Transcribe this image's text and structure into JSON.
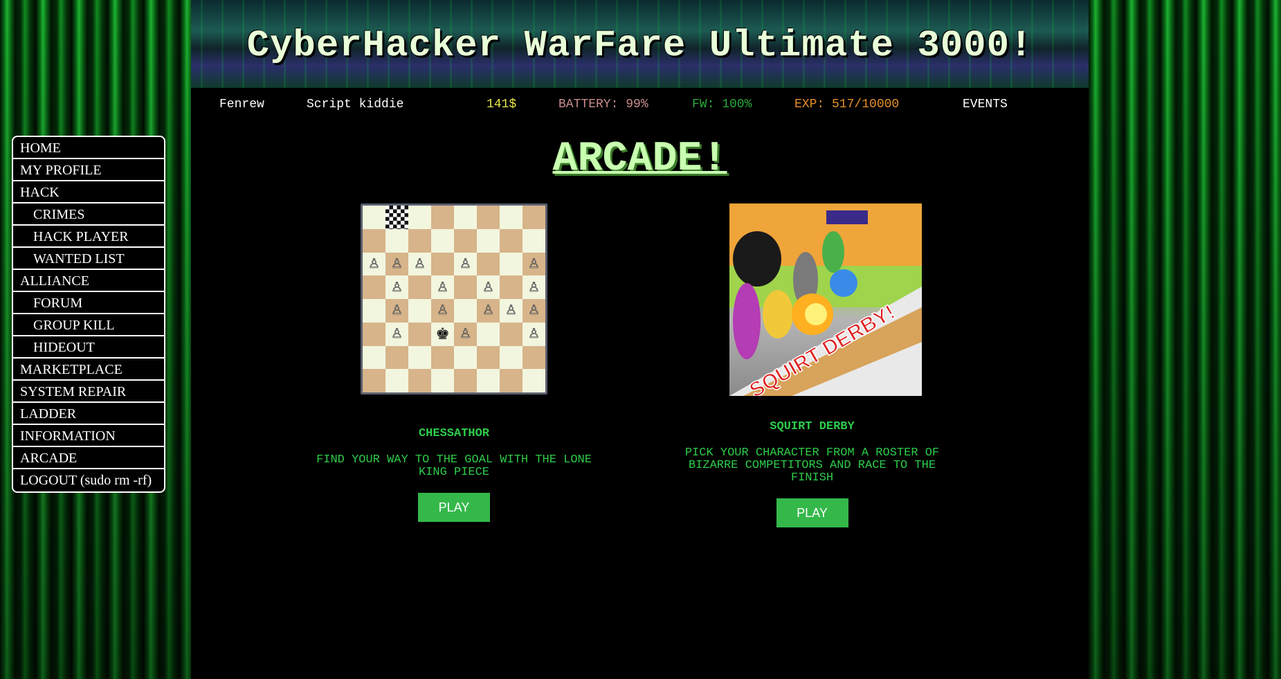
{
  "banner": {
    "title": "CyberHacker WarFare Ultimate 3000!"
  },
  "status": {
    "username": "Fenrew",
    "rank": "Script kiddie",
    "money": "141$",
    "battery": "BATTERY: 99%",
    "firewall": "FW: 100%",
    "experience": "EXP: 517/10000",
    "events": "EVENTS"
  },
  "page": {
    "title": "ARCADE!"
  },
  "nav": {
    "items": [
      {
        "label": "HOME",
        "sub": false
      },
      {
        "label": "MY PROFILE",
        "sub": false
      },
      {
        "label": "HACK",
        "sub": false
      },
      {
        "label": "CRIMES",
        "sub": true
      },
      {
        "label": "HACK PLAYER",
        "sub": true
      },
      {
        "label": "WANTED LIST",
        "sub": true
      },
      {
        "label": "ALLIANCE",
        "sub": false
      },
      {
        "label": "FORUM",
        "sub": true
      },
      {
        "label": "GROUP KILL",
        "sub": true
      },
      {
        "label": "HIDEOUT",
        "sub": true
      },
      {
        "label": "MARKETPLACE",
        "sub": false
      },
      {
        "label": "SYSTEM REPAIR",
        "sub": false
      },
      {
        "label": "LADDER",
        "sub": false
      },
      {
        "label": "INFORMATION",
        "sub": false
      },
      {
        "label": "ARCADE",
        "sub": false
      },
      {
        "label": "LOGOUT (sudo rm -rf)",
        "sub": false
      }
    ]
  },
  "games": [
    {
      "name": "CHESSATHOR",
      "description": "FIND YOUR WAY TO THE GOAL WITH THE LONE KING PIECE",
      "play_label": "PLAY",
      "board": [
        "........",
        "........",
        "PPP.P..P",
        ".P.P.P.P",
        ".P.P.PPP",
        ".P.KP..P",
        "........",
        "........"
      ],
      "goal_square": "b8"
    },
    {
      "name": "SQUIRT DERBY",
      "description": "PICK YOUR CHARACTER FROM A ROSTER OF BIZARRE COMPETITORS AND RACE TO THE FINISH",
      "play_label": "PLAY",
      "art_text": "SQUIRT DERBY!"
    }
  ],
  "colors": {
    "accent_green": "#2ecc4a",
    "play_button": "#34b84a",
    "money": "#e8e84a",
    "battery": "#c98c8c",
    "firewall": "#2aa83a",
    "experience": "#e8902a"
  }
}
